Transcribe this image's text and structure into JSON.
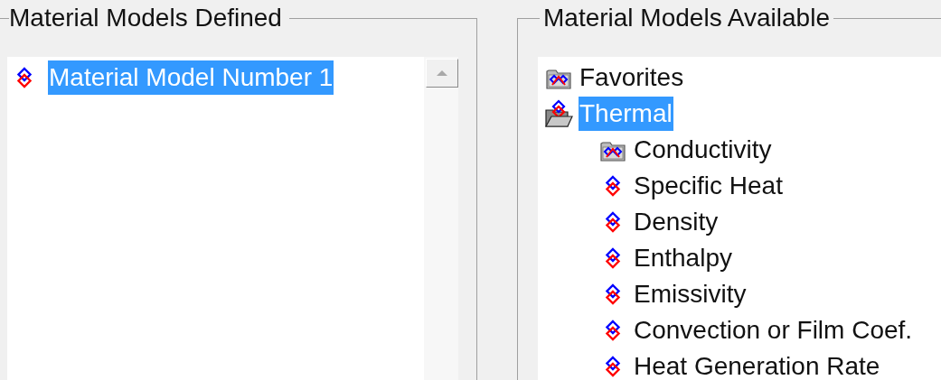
{
  "defined": {
    "title": "Material Models Defined",
    "items": [
      {
        "label": "Material Model Number 1",
        "kind": "model",
        "selected": true
      }
    ]
  },
  "available": {
    "title": "Material Models Available",
    "tree": [
      {
        "label": "Favorites",
        "kind": "folder",
        "expanded": false,
        "selected": false
      },
      {
        "label": "Thermal",
        "kind": "folder",
        "expanded": true,
        "selected": true,
        "children": [
          {
            "label": "Conductivity",
            "kind": "folder",
            "expanded": false,
            "selected": false
          },
          {
            "label": "Specific Heat",
            "kind": "model",
            "selected": false
          },
          {
            "label": "Density",
            "kind": "model",
            "selected": false
          },
          {
            "label": "Enthalpy",
            "kind": "model",
            "selected": false
          },
          {
            "label": "Emissivity",
            "kind": "model",
            "selected": false
          },
          {
            "label": "Convection or Film Coef.",
            "kind": "model",
            "selected": false
          },
          {
            "label": "Heat Generation Rate",
            "kind": "model",
            "selected": false
          }
        ]
      }
    ]
  }
}
